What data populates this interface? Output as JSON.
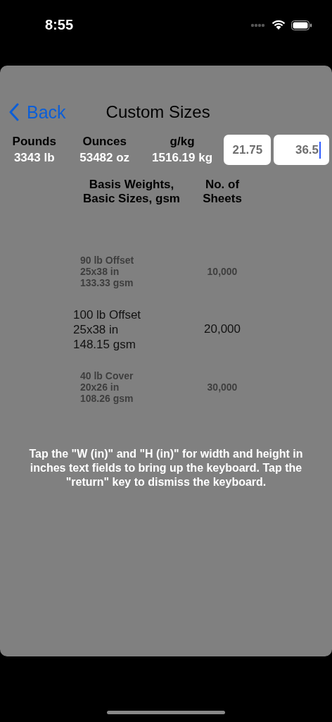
{
  "status_bar": {
    "time": "8:55"
  },
  "nav": {
    "back": "Back",
    "title": "Custom Sizes"
  },
  "weights": [
    {
      "label": "Pounds",
      "value": "3343 lb"
    },
    {
      "label": "Ounces",
      "value": "53482 oz"
    },
    {
      "label": "g/kg",
      "value": "1516.19 kg"
    }
  ],
  "fields": [
    {
      "value": "21.75",
      "focused": false
    },
    {
      "value": "36.5",
      "focused": true
    }
  ],
  "picker": {
    "columns": [
      "Basis Weights,\nBasic Sizes, gsm",
      "No. of\nSheets"
    ],
    "rows": [
      {
        "lines": [
          "90 lb Offset",
          "25x38 in",
          "133.33 gsm"
        ],
        "sheets": "10,000",
        "selected": false
      },
      {
        "lines": [
          "100 lb Offset",
          "25x38 in",
          "148.15 gsm"
        ],
        "sheets": "20,000",
        "selected": true
      },
      {
        "lines": [
          "40 lb Cover",
          "20x26 in",
          "108.26 gsm"
        ],
        "sheets": "30,000",
        "selected": false
      }
    ]
  },
  "instructions": "Tap  the \"W (in)\"  and \"H (in)\" for width and height in inches text fields to bring up the keyboard. Tap the \"return\" key to dismiss the keyboard."
}
